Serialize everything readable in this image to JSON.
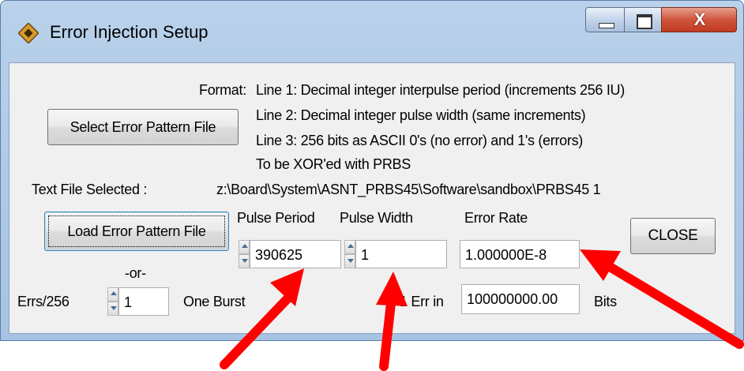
{
  "window": {
    "title": "Error Injection Setup",
    "close_glyph": "X"
  },
  "format": {
    "label": "Format:",
    "line1": "Line 1: Decimal integer interpulse period (increments 256 IU)",
    "line2": "Line 2: Decimal integer pulse width (same increments)",
    "line3": "Line 3: 256 bits as ASCII 0's (no error) and 1's (errors)",
    "line4": "To be XOR'ed with PRBS"
  },
  "buttons": {
    "select": "Select Error Pattern File",
    "load": "Load Error Pattern File",
    "close": "CLOSE"
  },
  "file": {
    "label": "Text File Selected :",
    "path": "z:\\Board\\System\\ASNT_PRBS45\\Software\\sandbox\\PRBS45 1"
  },
  "headers": {
    "pulse_period": "Pulse Period",
    "pulse_width": "Pulse Width",
    "error_rate": "Error Rate"
  },
  "fields": {
    "pulse_period": "390625",
    "pulse_width": "1",
    "error_rate": "1.000000E-8",
    "err_in": "100000000.00",
    "errs_256": "1"
  },
  "labels": {
    "or": "-or-",
    "errs_256": "Errs/256",
    "one_burst": "One Burst",
    "err_in": "1 Err in",
    "bits": "Bits"
  },
  "colors": {
    "annotation_arrow": "#ff0000",
    "title_bar": "#b9d1ea",
    "close_button": "#c8472c"
  }
}
